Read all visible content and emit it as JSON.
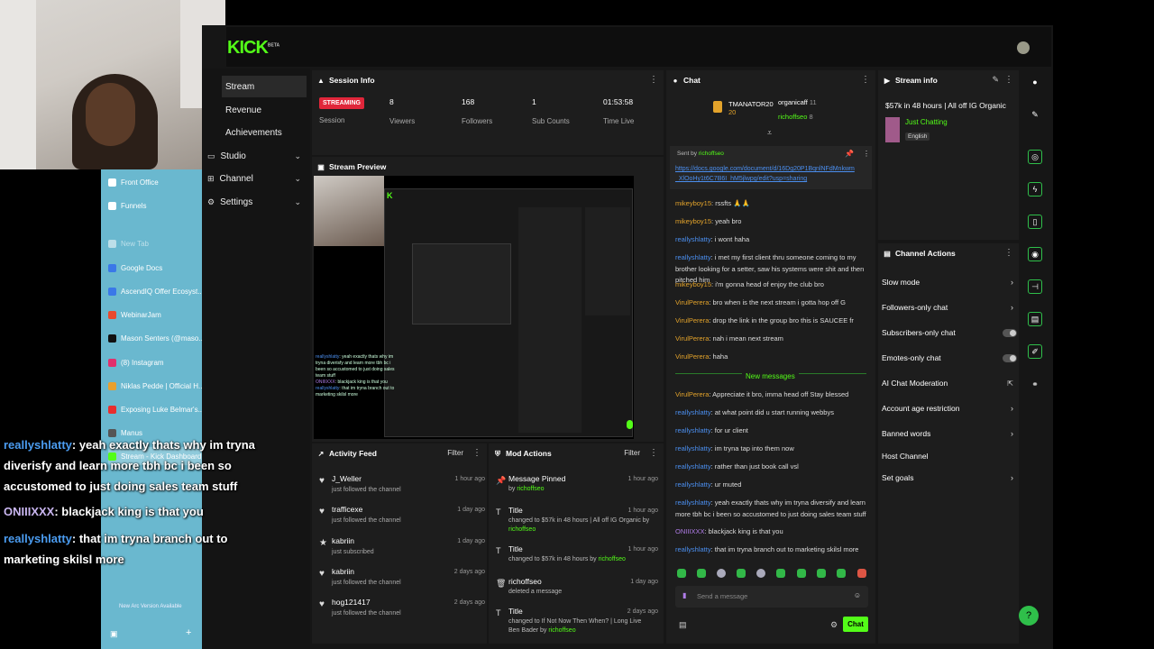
{
  "nav": {
    "items": [
      {
        "label": "Stream",
        "active": true
      },
      {
        "label": "Revenue"
      },
      {
        "label": "Achievements"
      },
      {
        "label": "Studio",
        "chevron": true
      },
      {
        "label": "Channel",
        "chevron": true
      },
      {
        "label": "Settings",
        "chevron": true
      }
    ]
  },
  "arc": {
    "tabs": [
      {
        "label": "Front Office",
        "color": "#ffffff"
      },
      {
        "label": "Funnels",
        "color": "#ffffff"
      },
      {
        "label": "New Tab",
        "color": "#ffffff",
        "dim": true
      },
      {
        "label": "Google Docs",
        "color": "#3a78e8"
      },
      {
        "label": "AscendIQ Offer Ecosyst...",
        "color": "#3a78e8"
      },
      {
        "label": "WebinarJam",
        "color": "#e8492e"
      },
      {
        "label": "Mason Senters (@maso...",
        "color": "#111111"
      },
      {
        "label": "(8) Instagram",
        "color": "#e1306c"
      },
      {
        "label": "Niklas Pedde | Official H...",
        "color": "#e8a02e"
      },
      {
        "label": "Exposing Luke Belmar's...",
        "color": "#e82e2e"
      },
      {
        "label": "Manus",
        "color": "#555555"
      },
      {
        "label": "Stream - Kick Dashboard",
        "color": "#53fc18",
        "active": true
      }
    ],
    "footer": "New Arc Version Available"
  },
  "session": {
    "title": "Session Info",
    "status": "STREAMING",
    "status_label": "Session",
    "viewers": "8",
    "viewers_label": "Viewers",
    "followers": "168",
    "followers_label": "Followers",
    "subs": "1",
    "subs_label": "Sub Counts",
    "time": "01:53:58",
    "time_label": "Time Live"
  },
  "preview": {
    "title": "Stream Preview"
  },
  "activity": {
    "title": "Activity Feed",
    "filter": "Filter",
    "rows": [
      {
        "name": "J_Weller",
        "sub": "just followed the channel",
        "time": "1 hour ago",
        "icon": "♥"
      },
      {
        "name": "trafficexe",
        "sub": "just followed the channel",
        "time": "1 day ago",
        "icon": "♥"
      },
      {
        "name": "kabriin",
        "sub": "just subscribed",
        "time": "1 day ago",
        "icon": "★"
      },
      {
        "name": "kabriin",
        "sub": "just followed the channel",
        "time": "2 days ago",
        "icon": "♥"
      },
      {
        "name": "hog121417",
        "sub": "just followed the channel",
        "time": "2 days ago",
        "icon": "♥"
      }
    ]
  },
  "mod": {
    "title": "Mod Actions",
    "filter": "Filter",
    "rows": [
      {
        "title": "Message Pinned",
        "desc_pre": "by ",
        "desc_user": "richoffseo",
        "desc_post": "",
        "time": "1 hour ago",
        "icon": "📌"
      },
      {
        "title": "Title",
        "desc_pre": "changed to $57k in 48 hours | All off IG Organic by ",
        "desc_user": "richoffseo",
        "desc_post": "",
        "time": "1 hour ago",
        "icon": "T"
      },
      {
        "title": "Title",
        "desc_pre": "changed to $57k in 48 hours by ",
        "desc_user": "richoffseo",
        "desc_post": "",
        "time": "1 hour ago",
        "icon": "T"
      },
      {
        "title": "richoffseo",
        "desc_pre": "deleted a message",
        "desc_user": "",
        "desc_post": "",
        "time": "1 day ago",
        "icon": "🗑"
      },
      {
        "title": "Title",
        "desc_pre": "changed to If Not Now Then When? | Long Live Ben Bader by ",
        "desc_user": "richoffseo",
        "desc_post": "",
        "time": "2 days ago",
        "icon": "T"
      }
    ]
  },
  "chat": {
    "title": "Chat",
    "leaders": [
      {
        "name": "TMANATOR20",
        "count": "20"
      },
      {
        "name": "organicaff",
        "count": "11"
      },
      {
        "name": "richoffseo",
        "count": "8"
      }
    ],
    "pinned": {
      "sent_by": "Sent by",
      "user": "richoffseo",
      "link": "https://docs.google.com/document/d/16Dg20P1BqnlNFdMnkwm_XlOoHy1t6C7B6I_hM5jlwpg/edit?usp=sharing"
    },
    "messages": [
      {
        "user": "mikeyboy15",
        "color": "y",
        "text": ": rssfts 🙏🙏"
      },
      {
        "user": "mikeyboy15",
        "color": "y",
        "text": ": yeah bro"
      },
      {
        "user": "reallyshlatty",
        "color": "b",
        "text": ": i wont haha"
      },
      {
        "user": "reallyshlatty",
        "color": "b",
        "text": ": i met my first client thru someone coming to my brother looking for a setter, saw his systems were shit and then pitched him"
      },
      {
        "user": "mikeyboy15",
        "color": "y",
        "text": ": i'm gonna head of enjoy the club bro"
      },
      {
        "user": "VirulPerera",
        "color": "y",
        "text": ": bro when is the next stream i gotta hop off G"
      },
      {
        "user": "VirulPerera",
        "color": "y",
        "text": ": drop the link in the group bro this is SAUCEE fr"
      },
      {
        "user": "VirulPerera",
        "color": "y",
        "text": ": nah i mean next stream"
      },
      {
        "user": "VirulPerera",
        "color": "y",
        "text": ": haha"
      }
    ],
    "new_messages": "New messages",
    "new": [
      {
        "user": "VirulPerera",
        "color": "y",
        "text": ": Appreciate it bro, imma head off Stay blessed"
      },
      {
        "user": "reallyshlatty",
        "color": "b",
        "text": ": at what point did u start running webbys"
      },
      {
        "user": "reallyshlatty",
        "color": "b",
        "text": ": for ur client"
      },
      {
        "user": "reallyshlatty",
        "color": "b",
        "text": ": im tryna tap into them now"
      },
      {
        "user": "reallyshlatty",
        "color": "b",
        "text": ": rather than just book call vsl"
      },
      {
        "user": "reallyshlatty",
        "color": "b",
        "text": ": ur muted"
      },
      {
        "user": "reallyshlatty",
        "color": "b",
        "text": ": yeah exactly thats why im tryna diversify and learn more tbh bc i been so accustomed to just doing sales team stuff"
      },
      {
        "user": "ONIIIXXX",
        "color": "p",
        "text": ": blackjack king is that you"
      },
      {
        "user": "reallyshlatty",
        "color": "b",
        "text": ": that im tryna branch out to marketing skilsl more"
      }
    ],
    "input_placeholder": "Send a message",
    "send": "Chat"
  },
  "stream_info": {
    "title": "Stream info",
    "stream_title": "$57k in 48 hours | All off IG Organic",
    "category": "Just Chatting",
    "language": "English"
  },
  "channel_actions": {
    "title": "Channel Actions",
    "rows": [
      {
        "label": "Slow mode",
        "kind": "arrow"
      },
      {
        "label": "Followers-only chat",
        "kind": "arrow"
      },
      {
        "label": "Subscribers-only chat",
        "kind": "toggle"
      },
      {
        "label": "Emotes-only chat",
        "kind": "toggle"
      },
      {
        "label": "AI Chat Moderation",
        "kind": "ext"
      },
      {
        "label": "Account age restriction",
        "kind": "arrow"
      },
      {
        "label": "Banned words",
        "kind": "arrow"
      },
      {
        "label": "Host Channel",
        "kind": "none"
      },
      {
        "label": "Set goals",
        "kind": "arrow"
      }
    ]
  },
  "overlay": {
    "lines": [
      {
        "user": "reallyshlatty",
        "style": "b",
        "text": ": yeah exactly thats why im tryna diverisfy and learn more tbh bc i been so accustomed to just doing sales team stuff"
      },
      {
        "user": "ONIIIXXX",
        "style": "p",
        "text": ": blackjack king is that you"
      },
      {
        "user": "reallyshlatty",
        "style": "b",
        "text": ": that im tryna branch out to marketing skilsl more"
      }
    ]
  }
}
